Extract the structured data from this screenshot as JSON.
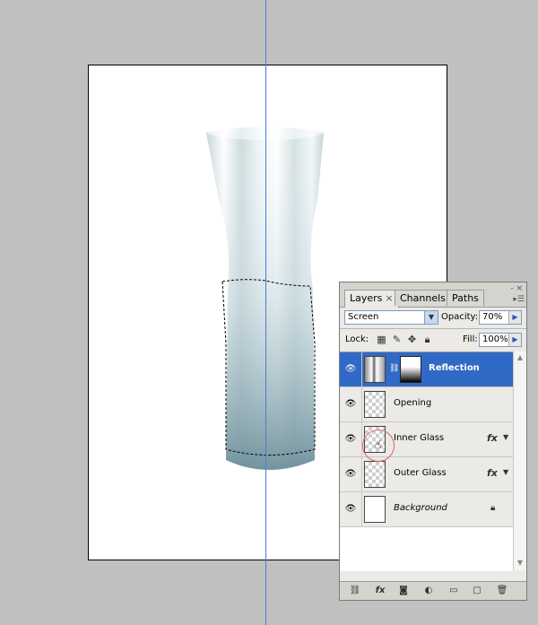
{
  "panel": {
    "tabs": [
      {
        "label": "Layers",
        "close": "×",
        "active": true
      },
      {
        "label": "Channels",
        "active": false
      },
      {
        "label": "Paths",
        "active": false
      }
    ],
    "window_controls": "- ×",
    "menu_icon": "options-menu-icon",
    "blend_mode": "Screen",
    "opacity_label": "Opacity:",
    "opacity_value": "70%",
    "lock_label": "Lock:",
    "fill_label": "Fill:",
    "fill_value": "100%"
  },
  "layers": [
    {
      "name": "Reflection",
      "selected": true,
      "has_mask": true,
      "fx": false
    },
    {
      "name": "Opening",
      "selected": false,
      "fx": false
    },
    {
      "name": "Inner Glass",
      "selected": false,
      "fx": true
    },
    {
      "name": "Outer Glass",
      "selected": false,
      "fx": true
    },
    {
      "name": "Background",
      "selected": false,
      "locked": true,
      "italic": true
    }
  ],
  "fx_label": "fx",
  "colors": {
    "workspace": "#c0c0c0",
    "selection": "#3169c6",
    "guide": "#4a7bd8",
    "glass_tint": "#7f9ea7"
  },
  "icons": [
    "eye-icon",
    "link-layers-icon",
    "fx-icon",
    "mask-icon",
    "adjustment-icon",
    "group-icon",
    "new-layer-icon",
    "trash-icon",
    "lock-icon",
    "hand-cursor-icon"
  ]
}
